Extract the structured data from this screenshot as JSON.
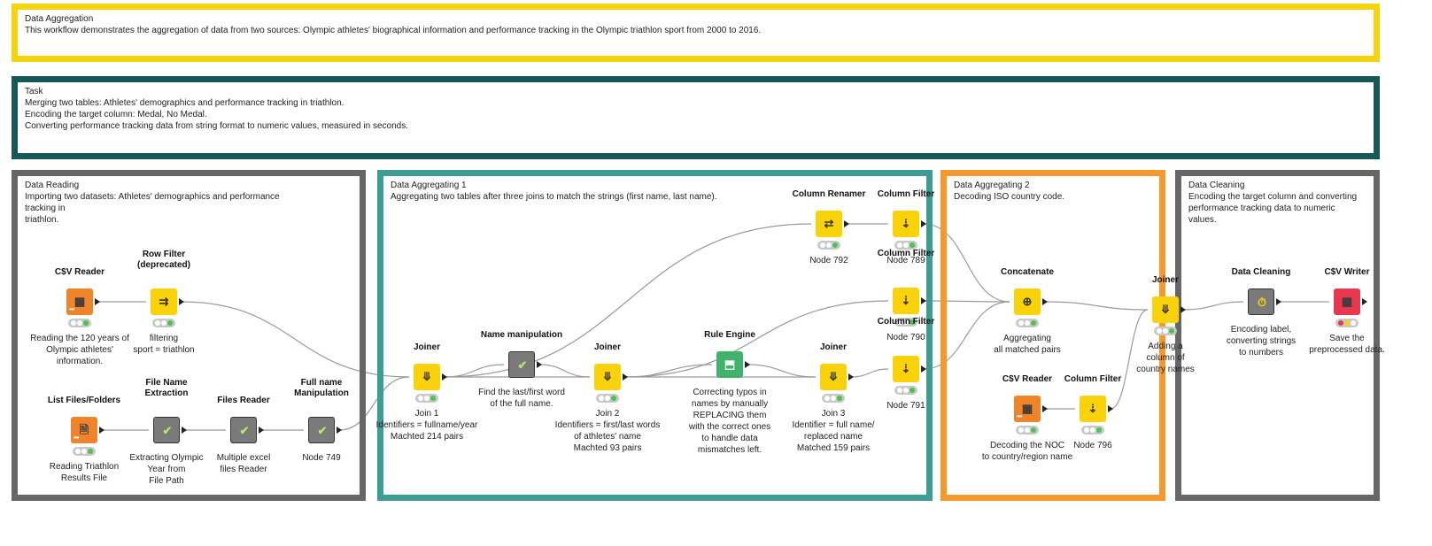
{
  "annotations": [
    {
      "id": "data-aggregation",
      "title": "Data Aggregation",
      "text": "This workflow demonstrates the aggregation of data from two sources: Olympic athletes' biographical information and performance tracking in the Olympic triathlon sport from 2000 to 2016.",
      "color": "#f6d30f"
    },
    {
      "id": "task",
      "title": "Task",
      "text": "Merging two tables: Athletes' demographics and performance tracking in triathlon.\nEncoding the target column: Medal, No Medal.\nConverting performance tracking data from string format to numeric values, measured in seconds.",
      "color": "#16575a"
    },
    {
      "id": "data-reading",
      "title": "Data Reading",
      "text": "Importing two datasets: Athletes' demographics and performance tracking in\ntriathlon.",
      "color": "#666666"
    },
    {
      "id": "data-aggregating-1",
      "title": "Data Aggregating 1",
      "text": "Aggregating two tables after three joins to match the strings (first name, last name).",
      "color": "#3d9c94"
    },
    {
      "id": "data-aggregating-2",
      "title": "Data Aggregating 2",
      "text": "Decoding ISO country code.",
      "color": "#f5992f"
    },
    {
      "id": "data-cleaning",
      "title": "Data Cleaning",
      "text": "Encoding the target column and converting\nperformance tracking data to numeric\nvalues.",
      "color": "#666666"
    }
  ],
  "nodes": [
    {
      "id": "csv-reader-1",
      "title": "C$V Reader",
      "caption": "Reading the 120 years of\nOlympic athletes'\ninformation.",
      "kind": "source",
      "color": "#f0842a",
      "glyph": "▦",
      "status": "green"
    },
    {
      "id": "row-filter",
      "title": "Row Filter\n(deprecated)",
      "caption": "filtering\nsport = triathlon",
      "kind": "manip",
      "color": "#f9d20a",
      "glyph": "⇉",
      "status": "green"
    },
    {
      "id": "list-files",
      "title": "List Files/Folders",
      "caption": "Reading Triathlon\nResults File",
      "kind": "source",
      "color": "#f0842a",
      "glyph": "🗎",
      "status": "green"
    },
    {
      "id": "file-name-extraction",
      "title": "File Name\nExtraction",
      "caption": "Extracting Olympic\nYear from\nFile Path",
      "kind": "meta",
      "color": "#7a7a7a",
      "glyph": "✔",
      "status": "none"
    },
    {
      "id": "files-reader",
      "title": "Files Reader",
      "caption": "Multiple excel\nfiles Reader",
      "kind": "meta",
      "color": "#7a7a7a",
      "glyph": "✔",
      "status": "none"
    },
    {
      "id": "full-name-manipulation",
      "title": "Full name\nManipulation",
      "caption": "Node 749",
      "kind": "meta",
      "color": "#7a7a7a",
      "glyph": "✔",
      "status": "none"
    },
    {
      "id": "joiner-1",
      "title": "Joiner",
      "caption": "Join 1\nIdentifiers = fullname/year\nMachted 214 pairs",
      "kind": "manip",
      "color": "#f9d20a",
      "glyph": "⤋",
      "status": "green"
    },
    {
      "id": "name-manipulation",
      "title": "Name manipulation",
      "caption": "Find the last/first word\nof the full name.",
      "kind": "meta",
      "color": "#7a7a7a",
      "glyph": "✔",
      "status": "none"
    },
    {
      "id": "joiner-2",
      "title": "Joiner",
      "caption": "Join 2\nIdentifiers = first/last words\nof athletes' name\nMachted 93 pairs",
      "kind": "manip",
      "color": "#f9d20a",
      "glyph": "⤋",
      "status": "green"
    },
    {
      "id": "rule-engine",
      "title": "Rule Engine",
      "caption": "Correcting typos in\nnames by manually\nREPLACING them\nwith the correct ones\nto handle data\nmismatches left.",
      "kind": "other",
      "color": "#3fb26b",
      "glyph": "⬒",
      "status": "none"
    },
    {
      "id": "joiner-3",
      "title": "Joiner",
      "caption": "Join 3\nIdentifier = full name/\nreplaced name\nMatched 159 pairs",
      "kind": "manip",
      "color": "#f9d20a",
      "glyph": "⤋",
      "status": "green"
    },
    {
      "id": "column-renamer",
      "title": "Column Renamer",
      "caption": "Node 792",
      "kind": "manip",
      "color": "#f9d20a",
      "glyph": "⇄",
      "status": "green"
    },
    {
      "id": "column-filter-789",
      "title": "Column Filter",
      "caption": "Node 789",
      "kind": "manip",
      "color": "#f9d20a",
      "glyph": "⇣",
      "status": "green"
    },
    {
      "id": "column-filter-790",
      "title": "Column Filter",
      "caption": "Node 790",
      "kind": "manip",
      "color": "#f9d20a",
      "glyph": "⇣",
      "status": "green"
    },
    {
      "id": "column-filter-791",
      "title": "Column Filter",
      "caption": "Node 791",
      "kind": "manip",
      "color": "#f9d20a",
      "glyph": "⇣",
      "status": "green"
    },
    {
      "id": "concatenate",
      "title": "Concatenate",
      "caption": "Aggregating\nall matched pairs",
      "kind": "manip",
      "color": "#f9d20a",
      "glyph": "⊕",
      "status": "green"
    },
    {
      "id": "csv-reader-2",
      "title": "C$V Reader",
      "caption": "Decoding the NOC\nto country/region name",
      "kind": "source",
      "color": "#f0842a",
      "glyph": "▦",
      "status": "green"
    },
    {
      "id": "column-filter-796",
      "title": "Column Filter",
      "caption": "Node 796",
      "kind": "manip",
      "color": "#f9d20a",
      "glyph": "⇣",
      "status": "green"
    },
    {
      "id": "joiner-4",
      "title": "Joiner",
      "caption": "Adding a\ncolumn of\ncountry names",
      "kind": "manip",
      "color": "#f9d20a",
      "glyph": "⤋",
      "status": "green"
    },
    {
      "id": "data-cleaning-node",
      "title": "Data Cleaning",
      "caption": "Encoding label,\nconverting strings\nto numbers",
      "kind": "meta",
      "color": "#7a7a7a",
      "glyph": "⏱",
      "status": "none"
    },
    {
      "id": "csv-writer",
      "title": "C$V Writer",
      "caption": "Save the\npreprocessed data.",
      "kind": "sink",
      "color": "#e8384f",
      "glyph": "▦",
      "status": "warn"
    }
  ]
}
